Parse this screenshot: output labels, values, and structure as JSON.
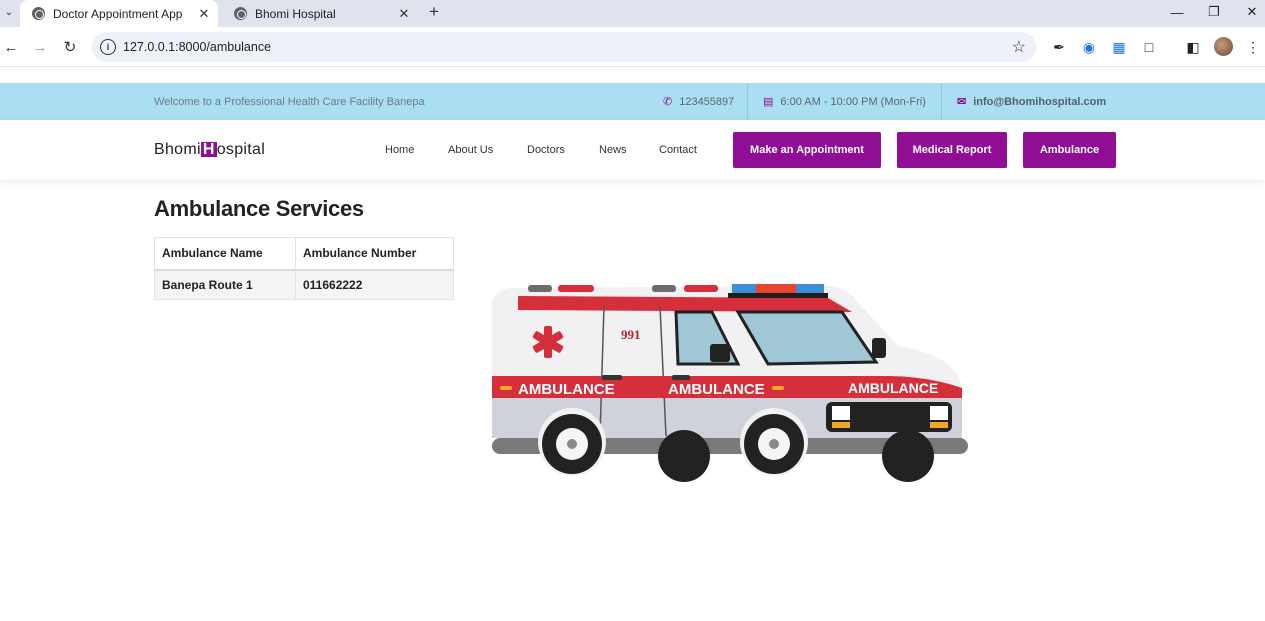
{
  "browser": {
    "tabs": [
      {
        "title": "Doctor Appointment App",
        "active": true
      },
      {
        "title": "Bhomi Hospital",
        "active": false
      }
    ],
    "url": "127.0.0.1:8000/ambulance"
  },
  "topbar": {
    "welcome": "Welcome to a Professional Health Care Facility Banepa",
    "phone": "123455897",
    "hours": "6:00 AM - 10:00 PM (Mon-Fri)",
    "email": "info@Bhomihospital.com"
  },
  "header": {
    "logo_prefix": "Bhomi",
    "logo_mark": "H",
    "logo_suffix": "ospital",
    "menu": [
      "Home",
      "About Us",
      "Doctors",
      "News",
      "Contact"
    ],
    "buttons": [
      "Make an Appointment",
      "Medical Report",
      "Ambulance"
    ]
  },
  "main": {
    "title": "Ambulance Services",
    "table": {
      "headers": [
        "Ambulance Name",
        "Ambulance Number"
      ],
      "rows": [
        [
          "Banepa Route 1",
          "011662222"
        ]
      ]
    },
    "image_text": {
      "number": "991",
      "label": "AMBULANCE"
    }
  },
  "colors": {
    "brand": "#8f0e95",
    "topbar": "#aadef1",
    "ambulance_red": "#d62f3c"
  }
}
